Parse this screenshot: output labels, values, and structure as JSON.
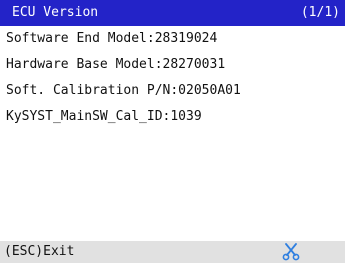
{
  "header": {
    "title": "ECU Version",
    "page_indicator": "(1/1)"
  },
  "info": [
    "Software End Model:28319024",
    "Hardware Base Model:28270031",
    "Soft. Calibration P/N:02050A01",
    "KySYST_MainSW_Cal_ID:1039"
  ],
  "footer": {
    "exit_label": "(ESC)Exit",
    "tool_icon": "scissors-icon"
  },
  "colors": {
    "title_bar": "#2323c8",
    "footer_bar": "#e1e1e1",
    "icon": "#2f7fe0"
  }
}
